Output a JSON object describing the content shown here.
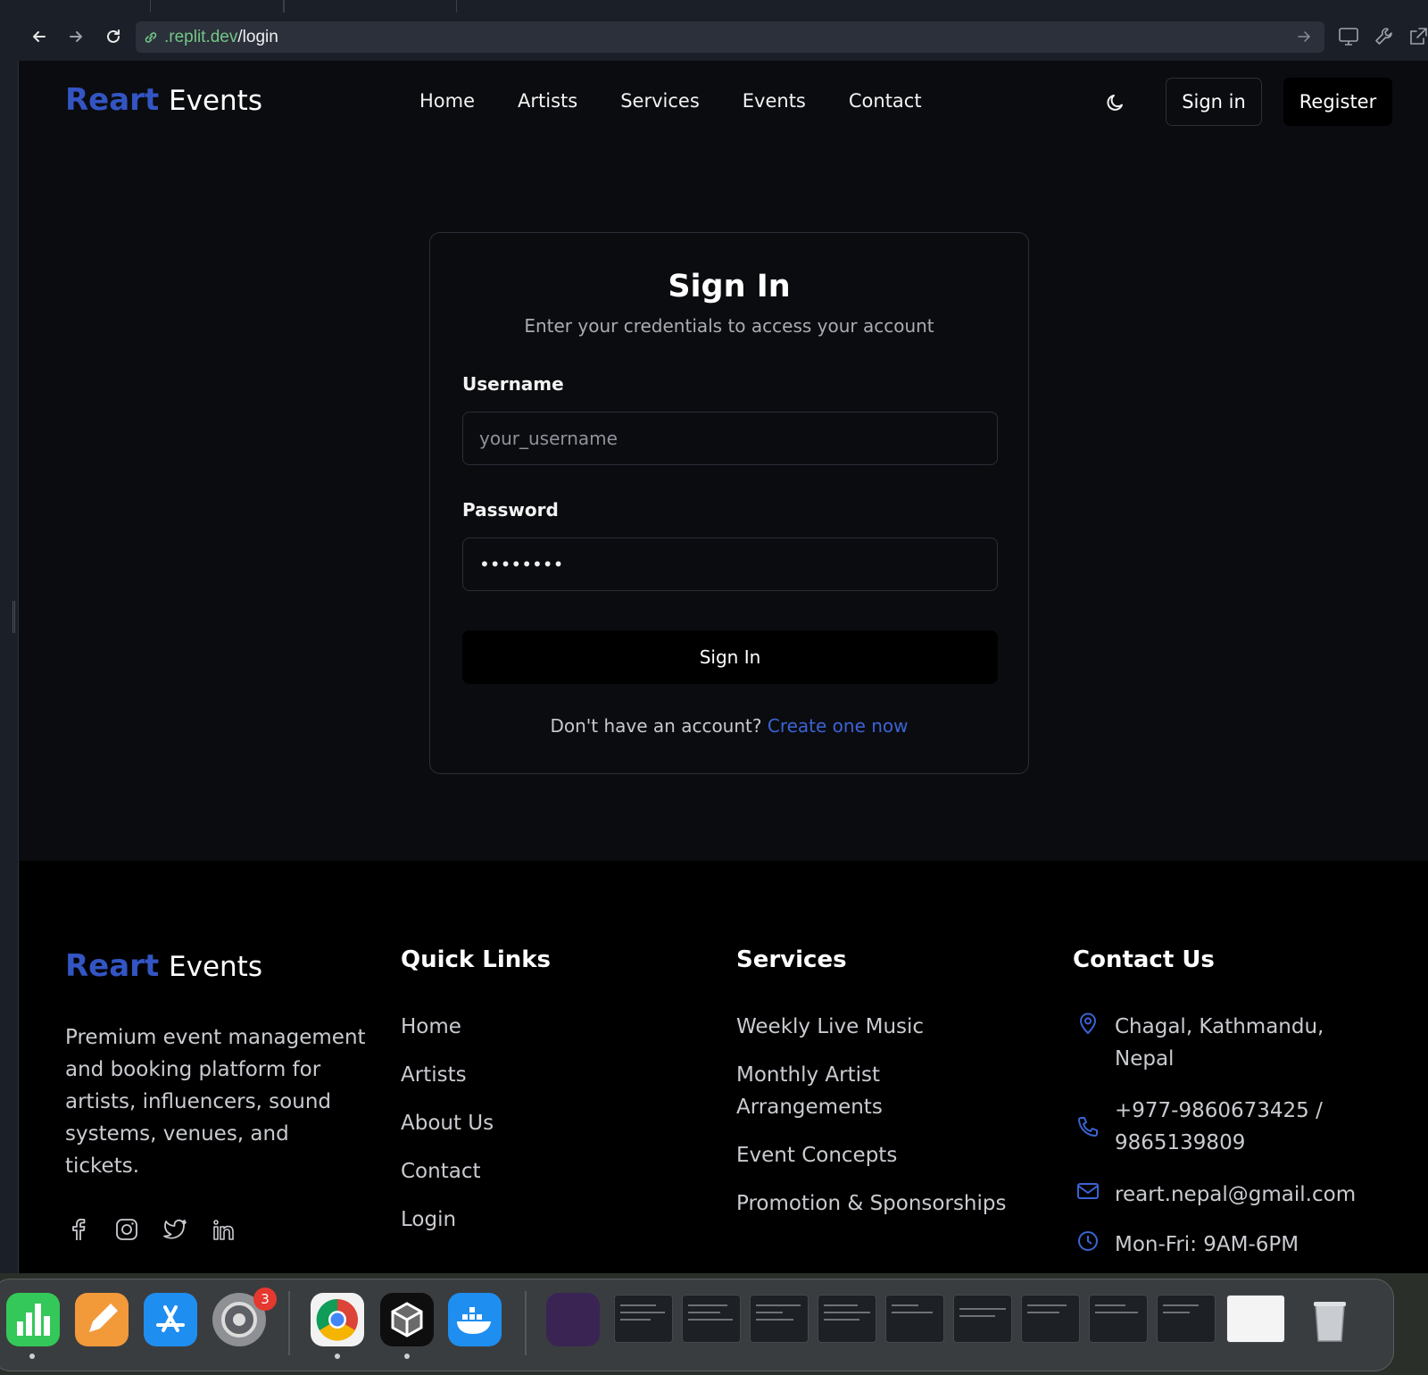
{
  "browser": {
    "url_domain": ".replit.dev",
    "url_path": "/login"
  },
  "nav": {
    "brand_primary": "Reart",
    "brand_secondary": "Events",
    "links": [
      "Home",
      "Artists",
      "Services",
      "Events",
      "Contact"
    ],
    "sign_in_label": "Sign in",
    "register_label": "Register"
  },
  "login": {
    "title": "Sign In",
    "subtitle": "Enter your credentials to access your account",
    "username_label": "Username",
    "username_placeholder": "your_username",
    "password_label": "Password",
    "password_value": "••••••••",
    "submit_label": "Sign In",
    "no_account_text": "Don't have an account?",
    "create_link": "Create one now"
  },
  "footer": {
    "brand_primary": "Reart",
    "brand_secondary": "Events",
    "description": "Premium event management and booking platform for artists, influencers, sound systems, venues, and tickets.",
    "quick_links_title": "Quick Links",
    "quick_links": [
      "Home",
      "Artists",
      "About Us",
      "Contact",
      "Login"
    ],
    "services_title": "Services",
    "services": [
      "Weekly Live Music",
      "Monthly Artist Arrangements",
      "Event Concepts",
      "Promotion & Sponsorships"
    ],
    "contact_title": "Contact Us",
    "address": "Chagal, Kathmandu, Nepal",
    "phone": "+977-9860673425 / 9865139809",
    "email": "reart.nepal@gmail.com",
    "hours": "Mon-Fri: 9AM-6PM"
  },
  "dock": {
    "settings_badge": "3"
  },
  "colors": {
    "brand_blue": "#3355c4",
    "link_blue": "#3b63d4",
    "page_bg": "#0b0c10",
    "footer_bg": "#000000"
  }
}
